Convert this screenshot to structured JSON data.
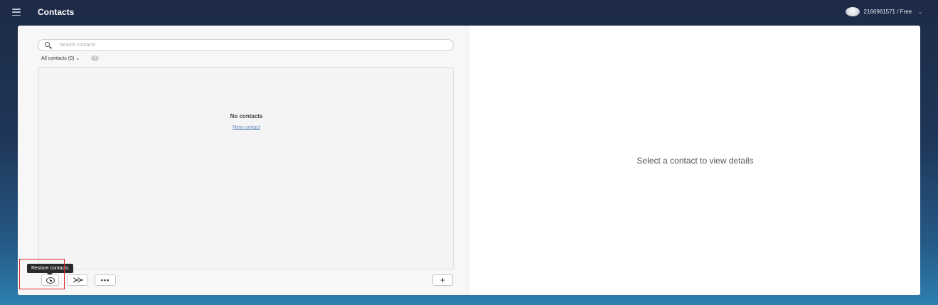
{
  "header": {
    "title": "Contacts",
    "account_label": "2166961571 / Free",
    "account_caret": "⌄"
  },
  "contacts": {
    "search": {
      "placeholder": "Search contacts",
      "value": ""
    },
    "filter_label": "All contacts (0) ⌄",
    "help_glyph": "?",
    "empty_title": "No contacts",
    "empty_link": "New contact"
  },
  "toolbar": {
    "restore_tooltip": "Restore contacts",
    "merge_glyph": "≻≻",
    "more_glyph": "•••",
    "add_glyph": "+"
  },
  "details": {
    "placeholder": "Select a contact to view details"
  },
  "colors": {
    "highlight": "#d9262b",
    "link": "#5a86b8"
  },
  "icons": [
    "menu-icon",
    "avatar",
    "search-icon",
    "help-icon",
    "restore-icon",
    "merge-icon",
    "more-icon",
    "plus-icon"
  ]
}
